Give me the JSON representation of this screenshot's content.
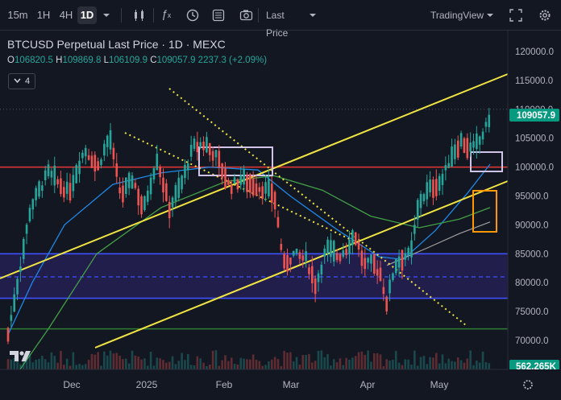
{
  "toolbar": {
    "timeframes": [
      "15m",
      "1H",
      "4H",
      "1D"
    ],
    "active_timeframe": "1D",
    "price_type": "Last Price",
    "view_name": "TradingView"
  },
  "symbol": {
    "title": "BTCUSD Perpetual Last Price · 1D · MEXC",
    "open_label": "O",
    "open": "106820.5",
    "high_label": "H",
    "high": "109869.8",
    "low_label": "L",
    "low": "106109.9",
    "close_label": "C",
    "close": "109057.9",
    "change": "2237.3 (+2.09%)",
    "indicator_count": "4"
  },
  "colors": {
    "background": "#131722",
    "up": "#26a69a",
    "down": "#ef5350",
    "trendline": "#f0e442",
    "support_line": "#e53935",
    "range_zone": "#2d2470",
    "range_border": "#3f51ff",
    "floor_line": "#2e7d32",
    "highlight_box": "#d1c4e9",
    "orange_box": "#ff9800"
  },
  "chart_data": {
    "type": "candlestick",
    "y_axis_ticks": [
      "120000.0",
      "115000.0",
      "110000.0",
      "105000.0",
      "100000.0",
      "95000.0",
      "90000.0",
      "85000.0",
      "80000.0",
      "75000.0",
      "70000.0"
    ],
    "x_axis_ticks": [
      "Dec",
      "2025",
      "Feb",
      "Mar",
      "Apr",
      "May"
    ],
    "last_price_label": "109057.9",
    "volume_label": "562.265K",
    "ylim": [
      69000,
      121500
    ],
    "horizontal_levels": [
      100000,
      85000,
      81000,
      77300,
      72000
    ],
    "range_zone": [
      77300,
      85000
    ]
  }
}
